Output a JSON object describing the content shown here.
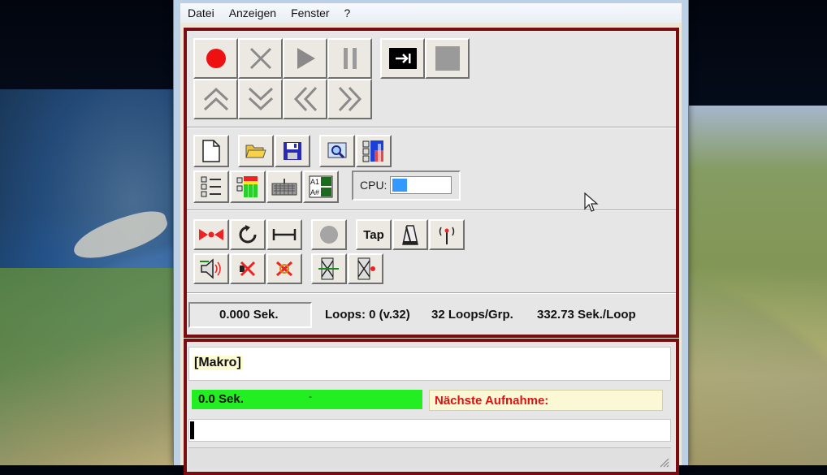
{
  "menu": [
    "Datei",
    "Anzeigen",
    "Fenster",
    "?"
  ],
  "status": {
    "time": "0.000 Sek.",
    "loops": "Loops: 0 (v.32)",
    "loops_group": "32 Loops/Grp.",
    "sec_loop": "332.73 Sek./Loop"
  },
  "cpu_label": "CPU:",
  "tap_label": "Tap",
  "macro_label": "[Makro]",
  "progress_text": "0.0 Sek.",
  "next_recording": "Nächste Aufnahme:",
  "colors": {
    "record": "#ee1111",
    "progress": "#22ee22",
    "frame": "#7a0d12",
    "cpu": "#3399ff"
  }
}
